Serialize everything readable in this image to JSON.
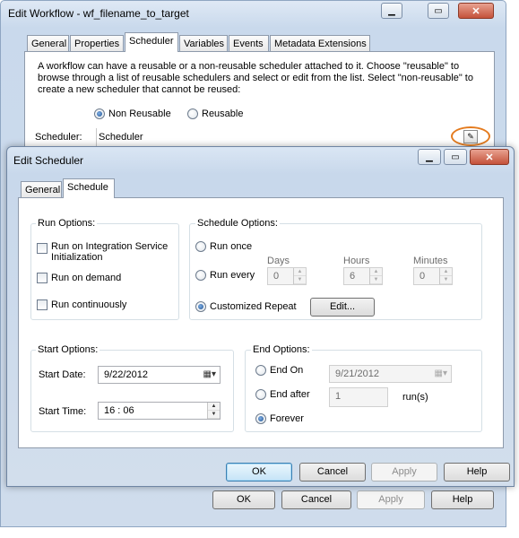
{
  "outer": {
    "title": "Edit Workflow - wf_filename_to_target",
    "tabs": [
      "General",
      "Properties",
      "Scheduler",
      "Variables",
      "Events",
      "Metadata Extensions"
    ],
    "description": "A workflow can have a reusable or a non-reusable scheduler attached to it.  Choose \"reusable\" to browse through a list of reusable schedulers and select or edit from the list.  Select \"non-reusable\" to create a new scheduler that cannot be reused:",
    "non_reusable_label": "Non Reusable",
    "reusable_label": "Reusable",
    "scheduler_label": "Scheduler:",
    "scheduler_value": "Scheduler",
    "buttons": {
      "ok": "OK",
      "cancel": "Cancel",
      "apply": "Apply",
      "help": "Help"
    }
  },
  "inner": {
    "title": "Edit Scheduler",
    "tabs": [
      "General",
      "Schedule"
    ],
    "run_options": {
      "legend": "Run Options:",
      "integration_service": "Run on Integration Service Initialization",
      "on_demand": "Run on demand",
      "continuously": "Run continuously"
    },
    "schedule_options": {
      "legend": "Schedule Options:",
      "run_once": "Run once",
      "run_every": "Run every",
      "days_label": "Days",
      "hours_label": "Hours",
      "minutes_label": "Minutes",
      "days_value": "0",
      "hours_value": "6",
      "minutes_value": "0",
      "customized_repeat": "Customized Repeat",
      "edit_button": "Edit..."
    },
    "start_options": {
      "legend": "Start Options:",
      "date_label": "Start Date:",
      "date_value": "9/22/2012",
      "time_label": "Start Time:",
      "time_value": "16 : 06"
    },
    "end_options": {
      "legend": "End Options:",
      "end_on": "End On",
      "end_on_value": "9/21/2012",
      "end_after": "End after",
      "end_after_value": "1",
      "runs_label": "run(s)",
      "forever": "Forever"
    },
    "buttons": {
      "ok": "OK",
      "cancel": "Cancel",
      "apply": "Apply",
      "help": "Help"
    }
  }
}
